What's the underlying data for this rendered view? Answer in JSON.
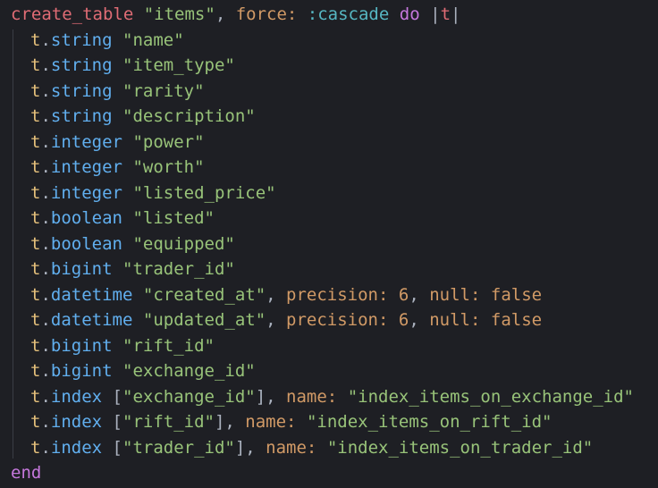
{
  "editor": {
    "header": {
      "method": "create_table",
      "table_name": "\"items\"",
      "force_key": "force:",
      "force_value": ":cascade",
      "do_keyword": "do",
      "block_param": "t"
    },
    "columns": [
      {
        "receiver": "t",
        "method": "string",
        "name": "\"name\""
      },
      {
        "receiver": "t",
        "method": "string",
        "name": "\"item_type\""
      },
      {
        "receiver": "t",
        "method": "string",
        "name": "\"rarity\""
      },
      {
        "receiver": "t",
        "method": "string",
        "name": "\"description\""
      },
      {
        "receiver": "t",
        "method": "integer",
        "name": "\"power\""
      },
      {
        "receiver": "t",
        "method": "integer",
        "name": "\"worth\""
      },
      {
        "receiver": "t",
        "method": "integer",
        "name": "\"listed_price\""
      },
      {
        "receiver": "t",
        "method": "boolean",
        "name": "\"listed\""
      },
      {
        "receiver": "t",
        "method": "boolean",
        "name": "\"equipped\""
      },
      {
        "receiver": "t",
        "method": "bigint",
        "name": "\"trader_id\""
      }
    ],
    "timestamps": [
      {
        "receiver": "t",
        "method": "datetime",
        "name": "\"created_at\"",
        "precision_key": "precision:",
        "precision_value": "6",
        "null_key": "null:",
        "null_value": "false"
      },
      {
        "receiver": "t",
        "method": "datetime",
        "name": "\"updated_at\"",
        "precision_key": "precision:",
        "precision_value": "6",
        "null_key": "null:",
        "null_value": "false"
      }
    ],
    "refs": [
      {
        "receiver": "t",
        "method": "bigint",
        "name": "\"rift_id\""
      },
      {
        "receiver": "t",
        "method": "bigint",
        "name": "\"exchange_id\""
      }
    ],
    "indexes": [
      {
        "receiver": "t",
        "method": "index",
        "columns": "\"exchange_id\"",
        "name_key": "name:",
        "name_value": "\"index_items_on_exchange_id\""
      },
      {
        "receiver": "t",
        "method": "index",
        "columns": "\"rift_id\"",
        "name_key": "name:",
        "name_value": "\"index_items_on_rift_id\""
      },
      {
        "receiver": "t",
        "method": "index",
        "columns": "\"trader_id\"",
        "name_key": "name:",
        "name_value": "\"index_items_on_trader_id\""
      }
    ],
    "footer": "end"
  }
}
